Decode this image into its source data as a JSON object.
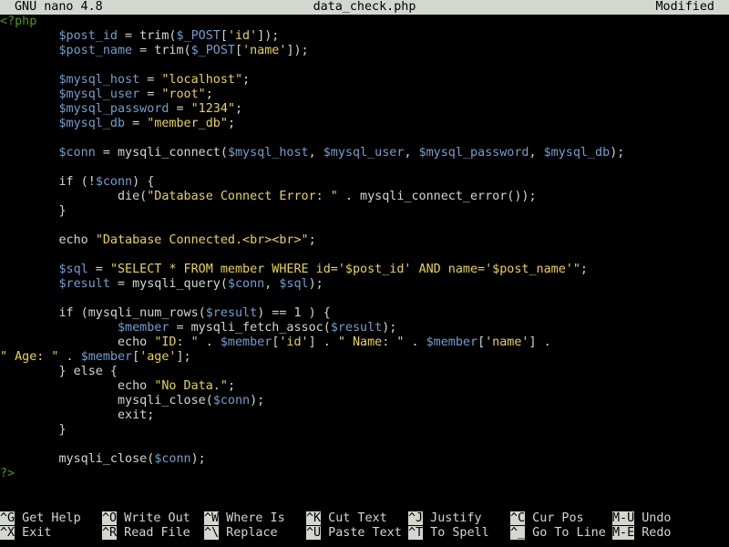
{
  "titlebar": {
    "app": "GNU nano 4.8",
    "filename": "data_check.php",
    "status": "Modified"
  },
  "code_lines": [
    [
      [
        "<?php",
        "tag"
      ]
    ],
    [
      [
        "        ",
        "plain"
      ],
      [
        "$post_id",
        "var"
      ],
      [
        " = trim(",
        "plain"
      ],
      [
        "$_POST",
        "var"
      ],
      [
        "[",
        "plain"
      ],
      [
        "'id'",
        "str"
      ],
      [
        "]);",
        "plain"
      ]
    ],
    [
      [
        "        ",
        "plain"
      ],
      [
        "$post_name",
        "var"
      ],
      [
        " = trim(",
        "plain"
      ],
      [
        "$_POST",
        "var"
      ],
      [
        "[",
        "plain"
      ],
      [
        "'name'",
        "str"
      ],
      [
        "]);",
        "plain"
      ]
    ],
    [],
    [
      [
        "        ",
        "plain"
      ],
      [
        "$mysql_host",
        "var"
      ],
      [
        " = ",
        "plain"
      ],
      [
        "\"localhost\"",
        "str"
      ],
      [
        ";",
        "plain"
      ]
    ],
    [
      [
        "        ",
        "plain"
      ],
      [
        "$mysql_user",
        "var"
      ],
      [
        " = ",
        "plain"
      ],
      [
        "\"root\"",
        "str"
      ],
      [
        ";",
        "plain"
      ]
    ],
    [
      [
        "        ",
        "plain"
      ],
      [
        "$mysql_password",
        "var"
      ],
      [
        " = ",
        "plain"
      ],
      [
        "\"1234\"",
        "str"
      ],
      [
        ";",
        "plain"
      ]
    ],
    [
      [
        "        ",
        "plain"
      ],
      [
        "$mysql_db",
        "var"
      ],
      [
        " = ",
        "plain"
      ],
      [
        "\"member_db\"",
        "str"
      ],
      [
        ";",
        "plain"
      ]
    ],
    [],
    [
      [
        "        ",
        "plain"
      ],
      [
        "$conn",
        "var"
      ],
      [
        " = mysqli_connect(",
        "plain"
      ],
      [
        "$mysql_host",
        "var"
      ],
      [
        ", ",
        "plain"
      ],
      [
        "$mysql_user",
        "var"
      ],
      [
        ", ",
        "plain"
      ],
      [
        "$mysql_password",
        "var"
      ],
      [
        ", ",
        "plain"
      ],
      [
        "$mysql_db",
        "var"
      ],
      [
        ");",
        "plain"
      ]
    ],
    [],
    [
      [
        "        ",
        "plain"
      ],
      [
        "if (!",
        "plain"
      ],
      [
        "$conn",
        "var"
      ],
      [
        ") {",
        "plain"
      ]
    ],
    [
      [
        "                ",
        "plain"
      ],
      [
        "die(",
        "plain"
      ],
      [
        "\"Database Connect Error: \"",
        "str"
      ],
      [
        " . mysqli_connect_error());",
        "plain"
      ]
    ],
    [
      [
        "        }",
        "plain"
      ]
    ],
    [],
    [
      [
        "        ",
        "plain"
      ],
      [
        "echo ",
        "plain"
      ],
      [
        "\"Database Connected.<br><br>\"",
        "str"
      ],
      [
        ";",
        "plain"
      ]
    ],
    [],
    [
      [
        "        ",
        "plain"
      ],
      [
        "$sql",
        "var"
      ],
      [
        " = ",
        "plain"
      ],
      [
        "\"SELECT * FROM member WHERE id='",
        "str"
      ],
      [
        "$post_id",
        "str"
      ],
      [
        "' AND name='",
        "str"
      ],
      [
        "$post_name",
        "str"
      ],
      [
        "'\"",
        "str"
      ],
      [
        ";",
        "plain"
      ]
    ],
    [
      [
        "        ",
        "plain"
      ],
      [
        "$result",
        "var"
      ],
      [
        " = mysqli_query(",
        "plain"
      ],
      [
        "$conn",
        "var"
      ],
      [
        ", ",
        "plain"
      ],
      [
        "$sql",
        "var"
      ],
      [
        ");",
        "plain"
      ]
    ],
    [],
    [
      [
        "        ",
        "plain"
      ],
      [
        "if (mysqli_num_rows(",
        "plain"
      ],
      [
        "$result",
        "var"
      ],
      [
        ") == 1 ) {",
        "plain"
      ]
    ],
    [
      [
        "                ",
        "plain"
      ],
      [
        "$member",
        "var"
      ],
      [
        " = mysqli_fetch_assoc(",
        "plain"
      ],
      [
        "$result",
        "var"
      ],
      [
        ");",
        "plain"
      ]
    ],
    [
      [
        "                ",
        "plain"
      ],
      [
        "echo ",
        "plain"
      ],
      [
        "\"ID: \"",
        "str"
      ],
      [
        " . ",
        "plain"
      ],
      [
        "$member",
        "var"
      ],
      [
        "[",
        "plain"
      ],
      [
        "'id'",
        "str"
      ],
      [
        "] . ",
        "plain"
      ],
      [
        "\" Name: \"",
        "str"
      ],
      [
        " . ",
        "plain"
      ],
      [
        "$member",
        "var"
      ],
      [
        "[",
        "plain"
      ],
      [
        "'name'",
        "str"
      ],
      [
        "] .",
        "plain"
      ]
    ],
    [
      [
        "\" Age: \"",
        "str"
      ],
      [
        " . ",
        "plain"
      ],
      [
        "$member",
        "var"
      ],
      [
        "[",
        "plain"
      ],
      [
        "'age'",
        "str"
      ],
      [
        "];",
        "plain"
      ]
    ],
    [
      [
        "        } else {",
        "plain"
      ]
    ],
    [
      [
        "                ",
        "plain"
      ],
      [
        "echo ",
        "plain"
      ],
      [
        "\"No Data.\"",
        "str"
      ],
      [
        ";",
        "plain"
      ]
    ],
    [
      [
        "                ",
        "plain"
      ],
      [
        "mysqli_close(",
        "plain"
      ],
      [
        "$conn",
        "var"
      ],
      [
        ");",
        "plain"
      ]
    ],
    [
      [
        "                ",
        "plain"
      ],
      [
        "exit;",
        "plain"
      ]
    ],
    [
      [
        "        }",
        "plain"
      ]
    ],
    [],
    [
      [
        "        ",
        "plain"
      ],
      [
        "mysqli_close(",
        "plain"
      ],
      [
        "$conn",
        "var"
      ],
      [
        ");",
        "plain"
      ]
    ],
    [
      [
        "?>",
        "tag"
      ]
    ]
  ],
  "shortcuts": [
    {
      "key": "^G",
      "label": "Get Help"
    },
    {
      "key": "^O",
      "label": "Write Out"
    },
    {
      "key": "^W",
      "label": "Where Is"
    },
    {
      "key": "^K",
      "label": "Cut Text"
    },
    {
      "key": "^J",
      "label": "Justify"
    },
    {
      "key": "^C",
      "label": "Cur Pos"
    },
    {
      "key": "M-U",
      "label": "Undo"
    },
    {
      "key": "^X",
      "label": "Exit"
    },
    {
      "key": "^R",
      "label": "Read File"
    },
    {
      "key": "^\\",
      "label": "Replace"
    },
    {
      "key": "^U",
      "label": "Paste Text"
    },
    {
      "key": "^T",
      "label": "To Spell"
    },
    {
      "key": "^_",
      "label": "Go To Line"
    },
    {
      "key": "M-E",
      "label": "Redo"
    }
  ],
  "colors": {
    "background": "#000000",
    "titlebar_bg": "#d3d7cf",
    "variable": "#729fcf",
    "string": "#e9d44c",
    "php_tag": "#4e9a06",
    "text": "#d3d7cf"
  }
}
